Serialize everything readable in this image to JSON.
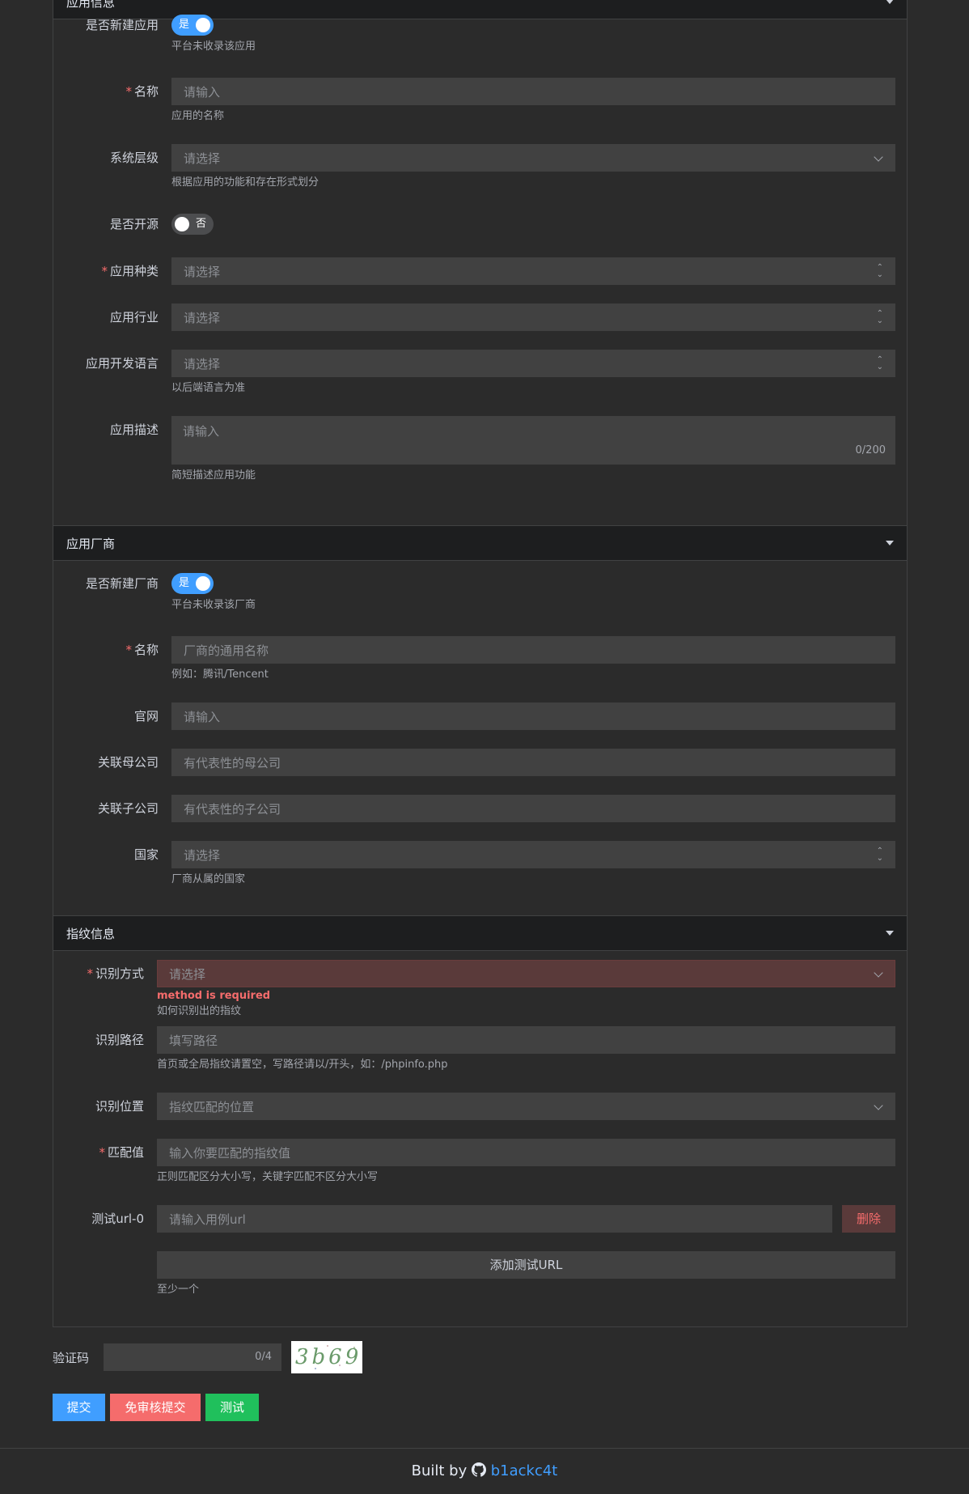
{
  "sections": {
    "app_info": {
      "title": "应用信息"
    },
    "vendor": {
      "title": "应用厂商"
    },
    "fingerprint": {
      "title": "指纹信息"
    }
  },
  "app": {
    "is_new": {
      "label": "是否新建应用",
      "toggle_text": "是",
      "hint": "平台未收录该应用"
    },
    "name": {
      "label": "名称",
      "placeholder": "请输入",
      "hint": "应用的名称"
    },
    "system_level": {
      "label": "系统层级",
      "placeholder": "请选择",
      "hint": "根据应用的功能和存在形式划分"
    },
    "open_source": {
      "label": "是否开源",
      "toggle_text": "否"
    },
    "category": {
      "label": "应用种类",
      "placeholder": "请选择"
    },
    "industry": {
      "label": "应用行业",
      "placeholder": "请选择"
    },
    "dev_language": {
      "label": "应用开发语言",
      "placeholder": "请选择",
      "hint": "以后端语言为准"
    },
    "description": {
      "label": "应用描述",
      "placeholder": "请输入",
      "counter": "0/200",
      "hint": "简短描述应用功能"
    }
  },
  "vendor": {
    "is_new": {
      "label": "是否新建厂商",
      "toggle_text": "是",
      "hint": "平台未收录该厂商"
    },
    "name": {
      "label": "名称",
      "placeholder": "厂商的通用名称",
      "hint": "例如：腾讯/Tencent"
    },
    "website": {
      "label": "官网",
      "placeholder": "请输入"
    },
    "parent": {
      "label": "关联母公司",
      "placeholder": "有代表性的母公司"
    },
    "subsidiary": {
      "label": "关联子公司",
      "placeholder": "有代表性的子公司"
    },
    "country": {
      "label": "国家",
      "placeholder": "请选择",
      "hint": "厂商从属的国家"
    }
  },
  "fingerprint": {
    "method": {
      "label": "识别方式",
      "placeholder": "请选择",
      "error": "method is required",
      "hint": "如何识别出的指纹"
    },
    "path": {
      "label": "识别路径",
      "placeholder": "填写路径",
      "hint": "首页或全局指纹请置空，写路径请以/开头，如：/phpinfo.php"
    },
    "location": {
      "label": "识别位置",
      "placeholder": "指纹匹配的位置"
    },
    "match_value": {
      "label": "匹配值",
      "placeholder": "输入你要匹配的指纹值",
      "hint": "正则匹配区分大小写，关键字匹配不区分大小写"
    },
    "test_url": {
      "label": "测试url-0",
      "placeholder": "请输入用例url",
      "delete_label": "删除"
    },
    "add_url": {
      "label": "添加测试URL",
      "hint": "至少一个"
    }
  },
  "captcha": {
    "label": "验证码",
    "counter": "0/4",
    "image_text": "3b69"
  },
  "actions": {
    "submit": "提交",
    "submit_no_review": "免审核提交",
    "test": "测试"
  },
  "footer": {
    "prefix": "Built by",
    "link": "b1ackc4t"
  },
  "colors": {
    "primary": "#409eff",
    "danger": "#f56c6c",
    "success": "#20c05c",
    "bg": "#2b2b2b",
    "input_bg": "#414141"
  }
}
